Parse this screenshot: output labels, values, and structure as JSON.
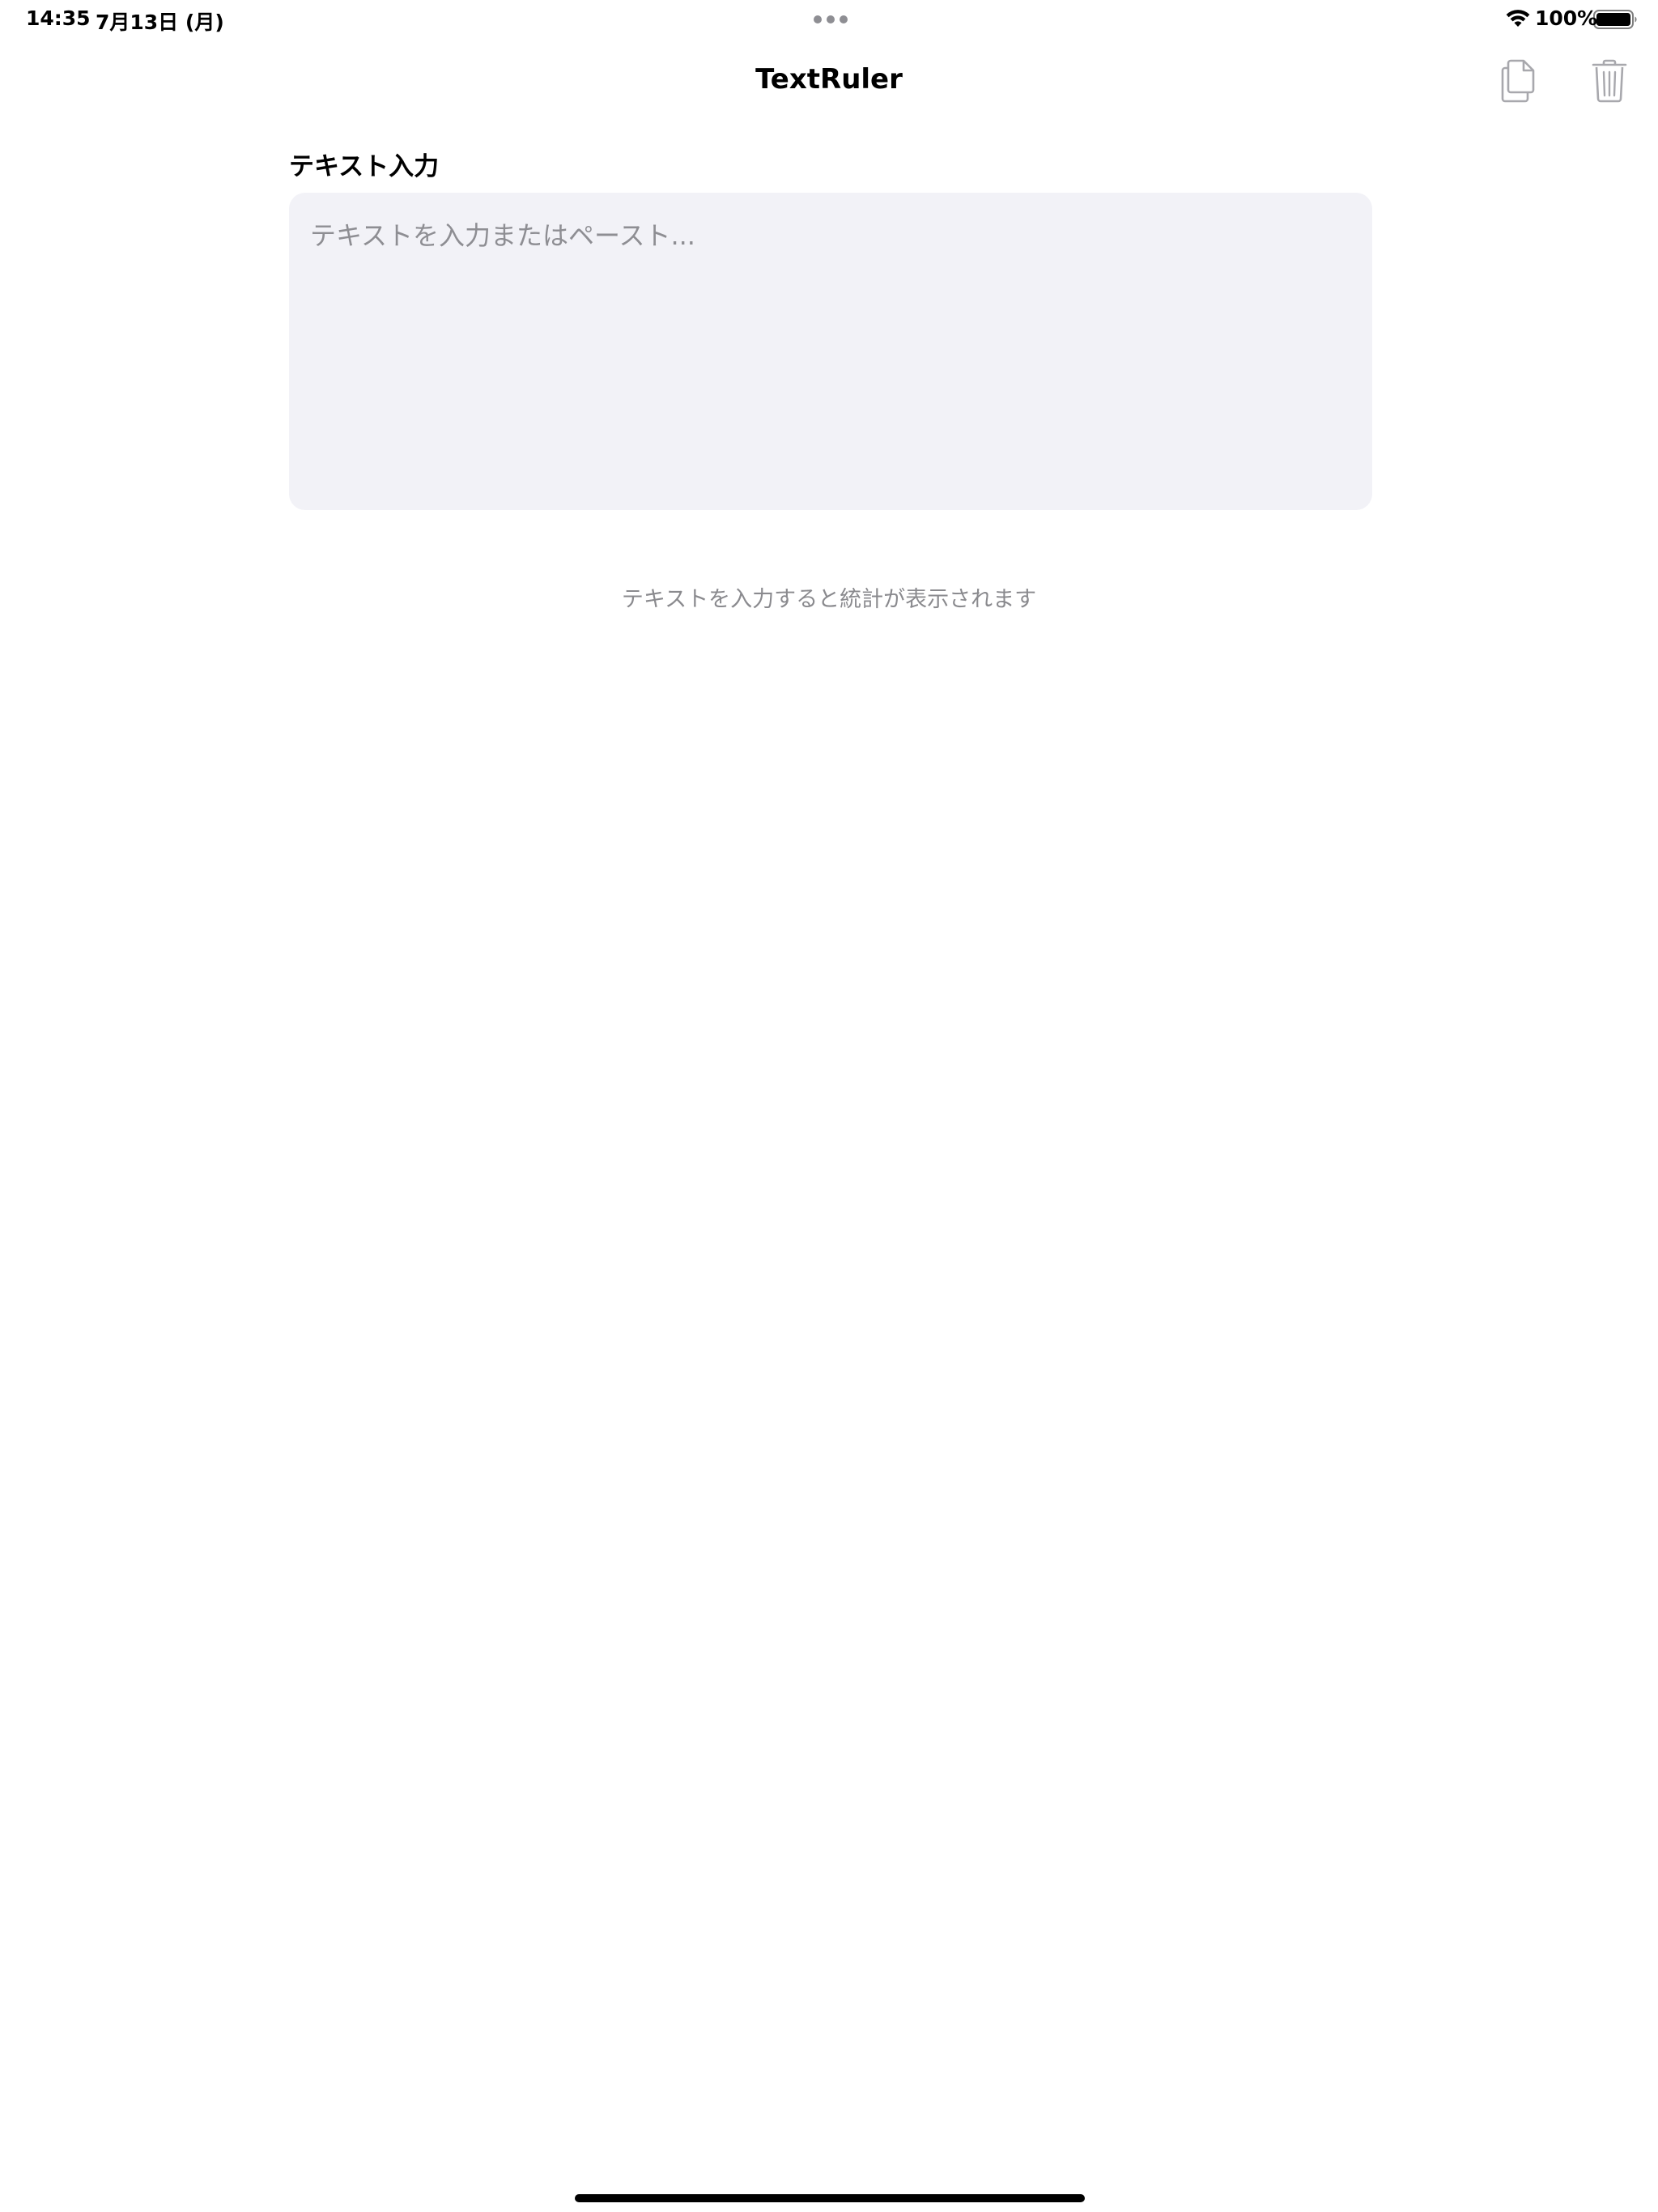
{
  "status_bar": {
    "time": "14:35",
    "date": "7月13日 (月)",
    "battery_percent": "100%",
    "wifi_icon": "wifi-icon",
    "battery_icon": "battery-full-icon",
    "multitask_icon": "multitask-dots-icon"
  },
  "nav": {
    "title": "TextRuler",
    "copy_icon": "copy-icon",
    "trash_icon": "trash-icon"
  },
  "input_section": {
    "label": "テキスト入力",
    "value": "",
    "placeholder": "テキストを入力またはペースト..."
  },
  "stats": {
    "empty_message": "テキストを入力すると統計が表示されます"
  },
  "colors": {
    "input_background": "#f2f2f7",
    "secondary_text": "#8e8e93",
    "disabled_icon": "#a8a8ad"
  }
}
